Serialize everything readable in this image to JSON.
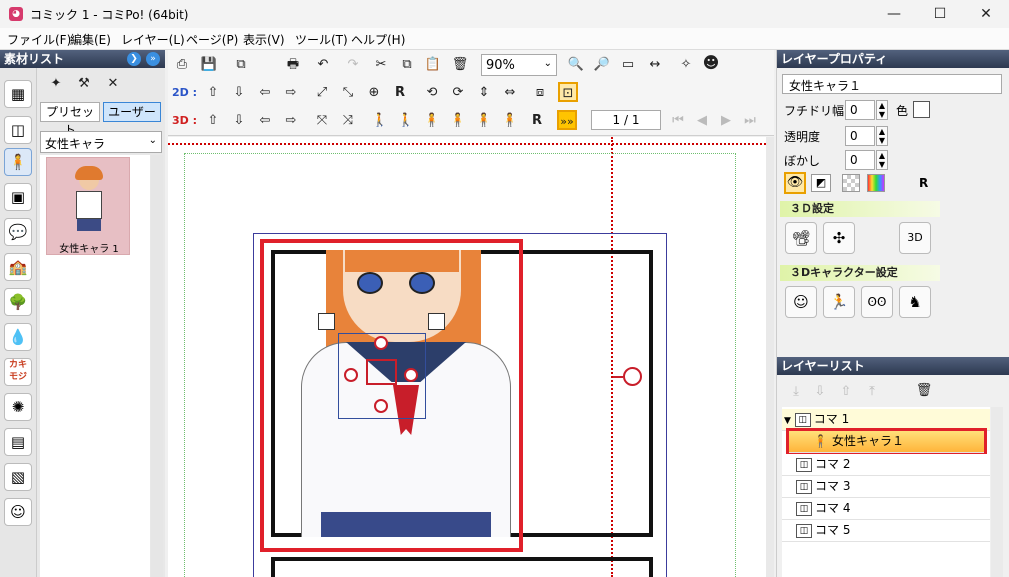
{
  "window": {
    "title": "コミック 1 - コミPo! (64bit)",
    "app_icon": "◕"
  },
  "controls": {
    "minimize": "—",
    "maximize": "☐",
    "close": "✕"
  },
  "menu": [
    "ファイル(F)",
    "編集(E)",
    "レイヤー(L)",
    "ページ(P)",
    "表示(V)",
    "ツール(T)",
    "ヘルプ(H)"
  ],
  "left": {
    "header": "素材リスト",
    "tabs": {
      "preset": "プリセット",
      "user": "ユーザー"
    },
    "dropdown": "女性キャラ",
    "thumb_label": "女性キャラ 1",
    "kaki_label": "カキ\nモジ"
  },
  "toolbar": {
    "zoom": "90%",
    "label_2d": "2D :",
    "label_3d": "3D :",
    "page": "1 / 1"
  },
  "props": {
    "header": "レイヤープロパティ",
    "name": "女性キャラ１",
    "border_label": "フチドリ幅",
    "border_value": "0",
    "color_label": "色",
    "opacity_label": "透明度",
    "opacity_value": "0",
    "blur_label": "ぼかし",
    "blur_value": "0",
    "section_3d": "３Ｄ設定",
    "section_3dchar": "３Dキャラクター設定"
  },
  "layers": {
    "header": "レイヤーリスト",
    "koma1": "コマ 1",
    "child": "女性キャラ１",
    "rows": [
      "コマ 2",
      "コマ 3",
      "コマ 4",
      "コマ 5"
    ]
  },
  "colors": {
    "highlight": "#e0202a",
    "selected_row": "#ffc74d",
    "header_bg": "#34405a"
  }
}
